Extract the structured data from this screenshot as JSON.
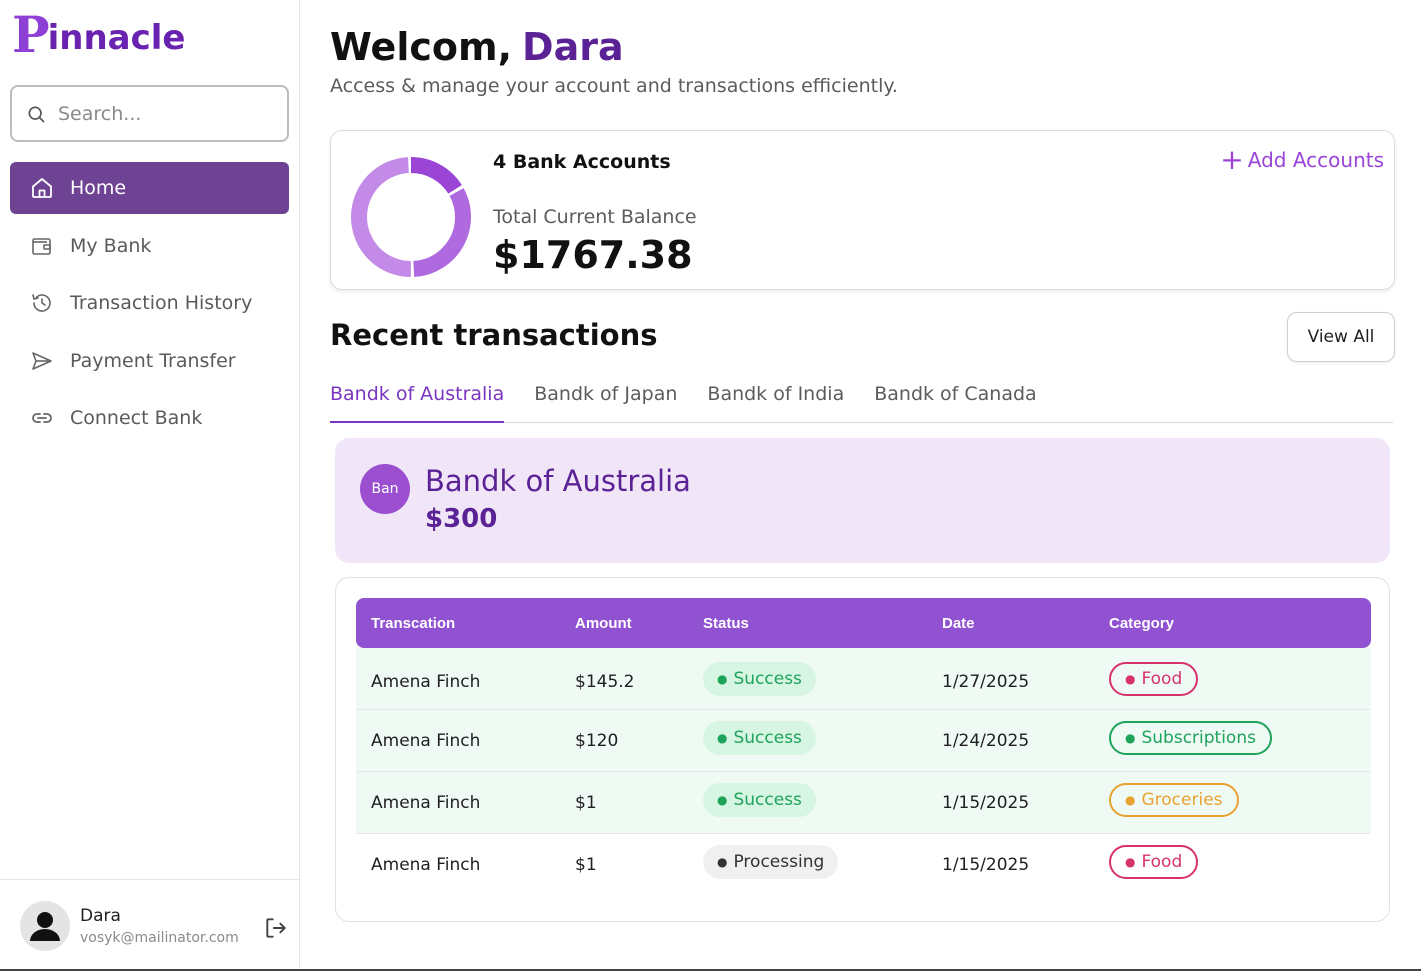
{
  "brand": {
    "logo_initial": "P",
    "logo_rest": "innacle"
  },
  "search": {
    "placeholder": "Search..."
  },
  "sidebar": {
    "items": [
      {
        "label": "Home",
        "icon": "home-icon",
        "active": true
      },
      {
        "label": "My Bank",
        "icon": "wallet-icon",
        "active": false
      },
      {
        "label": "Transaction History",
        "icon": "history-icon",
        "active": false
      },
      {
        "label": "Payment Transfer",
        "icon": "send-icon",
        "active": false
      },
      {
        "label": "Connect Bank",
        "icon": "link-icon",
        "active": false
      }
    ]
  },
  "user": {
    "name": "Dara",
    "email": "vosyk@mailinator.com"
  },
  "header": {
    "greeting": "Welcom,",
    "name": "Dara",
    "subtitle": "Access & manage your account and transactions efficiently."
  },
  "balance": {
    "account_count": "4 Bank Accounts",
    "add_label": "Add Accounts",
    "total_label": "Total Current Balance",
    "total_value": "$1767.38",
    "donut_shares": [
      0.17,
      0.33,
      0.5
    ],
    "donut_colors": [
      "#9a45d6",
      "#b06ae0",
      "#c38ae8"
    ]
  },
  "recent": {
    "title": "Recent transactions",
    "view_all": "View All",
    "tabs": [
      "Bandk of Australia",
      "Bandk of Japan",
      "Bandk of India",
      "Bandk of Canada"
    ],
    "active_tab": 0
  },
  "bank": {
    "badge": "Ban",
    "name": "Bandk of Australia",
    "amount": "$300"
  },
  "table": {
    "columns": [
      "Transcation",
      "Amount",
      "Status",
      "Date",
      "Category"
    ],
    "rows": [
      {
        "name": "Amena Finch",
        "amount": "$145.2",
        "status": "Success",
        "date": "1/27/2025",
        "category": "Food"
      },
      {
        "name": "Amena Finch",
        "amount": "$120",
        "status": "Success",
        "date": "1/24/2025",
        "category": "Subscriptions"
      },
      {
        "name": "Amena Finch",
        "amount": "$1",
        "status": "Success",
        "date": "1/15/2025",
        "category": "Groceries"
      },
      {
        "name": "Amena Finch",
        "amount": "$1",
        "status": "Processing",
        "date": "1/15/2025",
        "category": "Food"
      }
    ]
  },
  "colors": {
    "accent": "#6e4394",
    "brand_purple": "#5b2296",
    "success": "#1ea35a",
    "food": "#d6336c",
    "groceries": "#e8a232"
  }
}
